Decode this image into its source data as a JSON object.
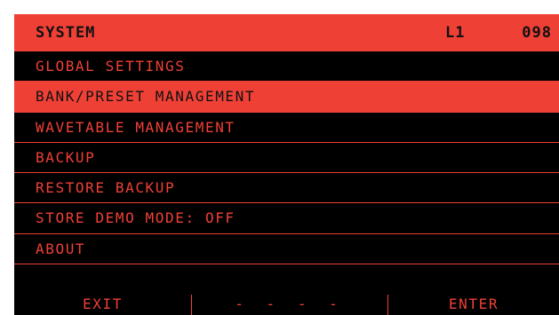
{
  "header": {
    "title": "SYSTEM",
    "bank": "L1",
    "preset": "098"
  },
  "menu": {
    "items": [
      {
        "label": "GLOBAL SETTINGS",
        "selected": false
      },
      {
        "label": "BANK/PRESET MANAGEMENT",
        "selected": true
      },
      {
        "label": "WAVETABLE MANAGEMENT",
        "selected": false
      },
      {
        "label": "BACKUP",
        "selected": false
      },
      {
        "label": "RESTORE BACKUP",
        "selected": false
      },
      {
        "label": "STORE DEMO MODE: OFF",
        "selected": false
      },
      {
        "label": "ABOUT",
        "selected": false
      }
    ]
  },
  "footer": {
    "exit_label": "EXIT",
    "middle_label": "- - - -",
    "enter_label": "ENTER"
  },
  "colors": {
    "accent": "#ef4036",
    "background": "#000000",
    "dark_text": "#111111"
  }
}
